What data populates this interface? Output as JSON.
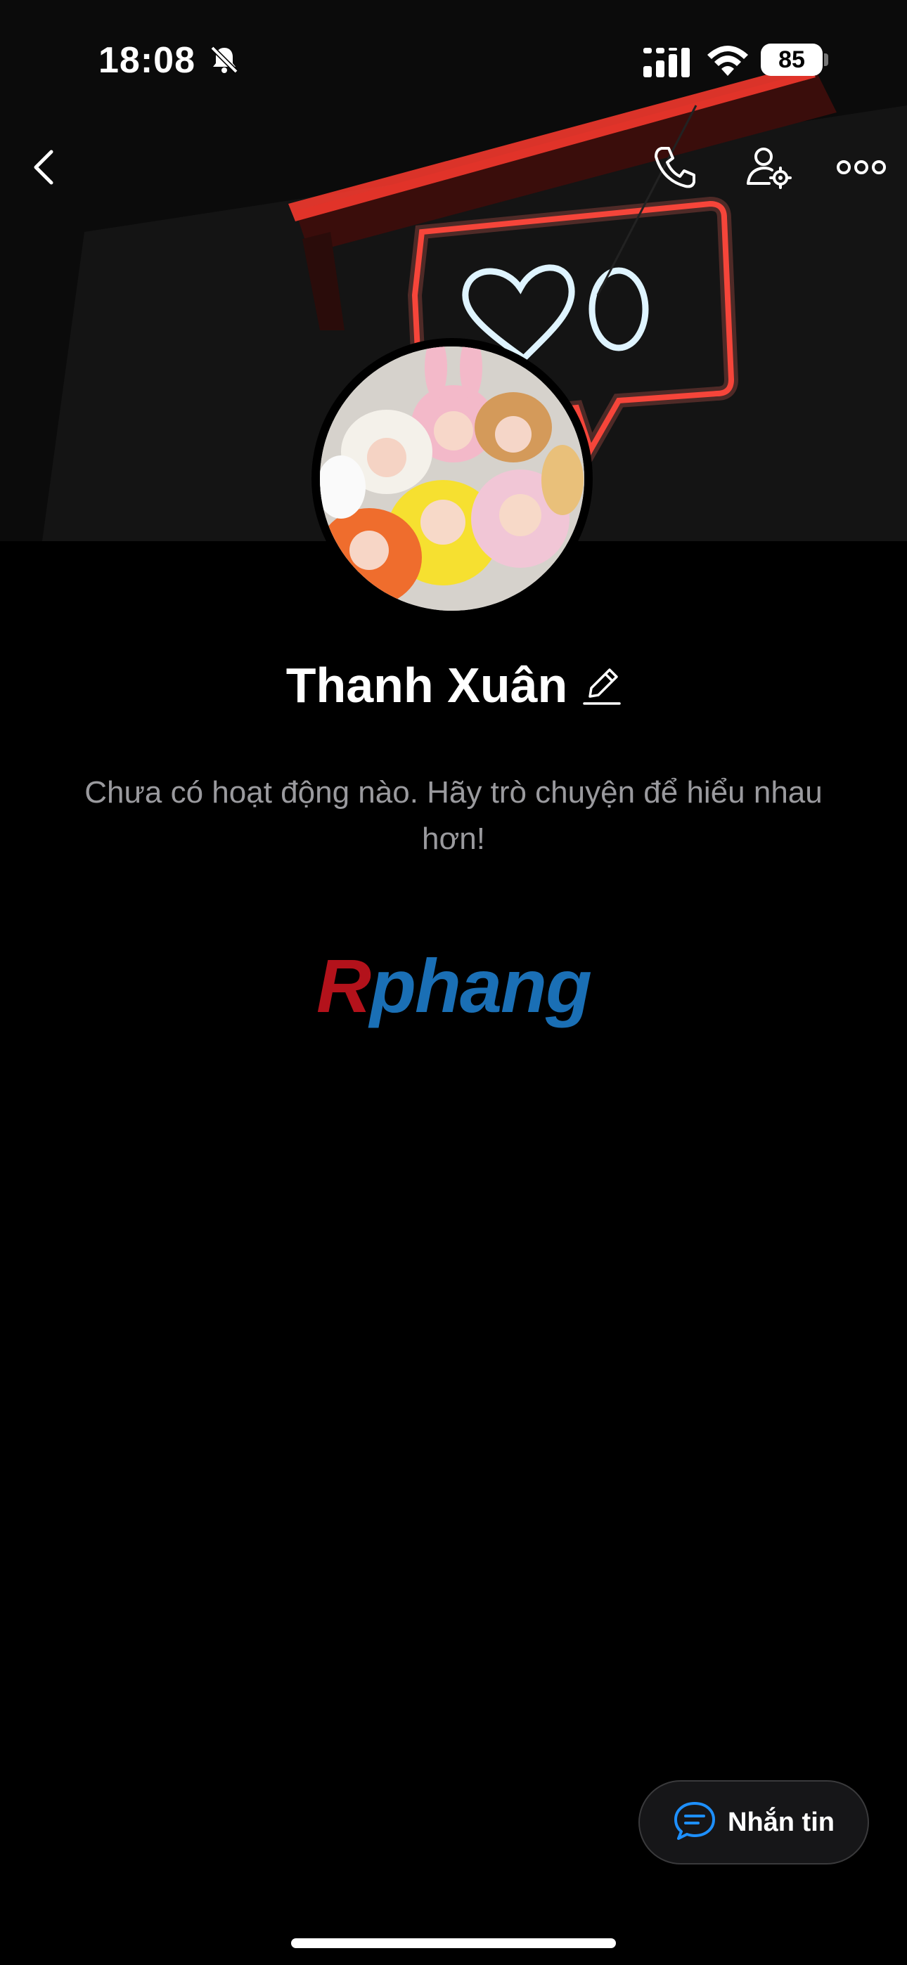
{
  "status_bar": {
    "time": "18:08",
    "battery": "85",
    "icons": [
      "bell-slash-icon",
      "cellular-signal-icon",
      "wifi-icon",
      "battery-icon"
    ]
  },
  "nav": {
    "icons": [
      "back-chevron-icon",
      "phone-icon",
      "user-settings-icon",
      "more-dots-icon"
    ]
  },
  "profile": {
    "name": "Thanh Xuân",
    "empty_message": "Chưa có hoạt động nào. Hãy trò chuyện để hiểu nhau hơn!"
  },
  "watermark": {
    "first_letter": "R",
    "rest": "phang"
  },
  "actions": {
    "message_label": "Nhắn tin"
  },
  "colors": {
    "background": "#000000",
    "neon_red": "#ff3b2f",
    "neon_white": "#dff4ff",
    "accent_blue": "#1e90ff"
  }
}
